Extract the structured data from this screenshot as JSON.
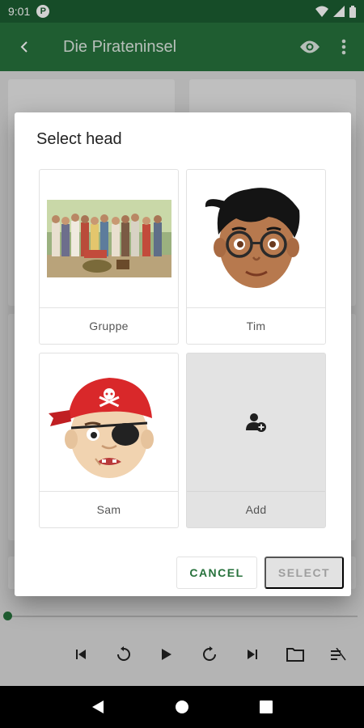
{
  "status_bar": {
    "time": "9:01",
    "notification_icon": "P"
  },
  "app_bar": {
    "title": "Die Pirateninsel"
  },
  "dialog": {
    "title": "Select head",
    "items": [
      {
        "label": "Gruppe",
        "image": "group-photo"
      },
      {
        "label": "Tim",
        "image": "boy-face-glasses"
      },
      {
        "label": "Sam",
        "image": "pirate-face-eyepatch"
      },
      {
        "label": "Add",
        "image": "add-person-icon"
      }
    ],
    "cancel_label": "CANCEL",
    "select_label": "SELECT"
  },
  "colors": {
    "status_bar": "#1c5d31",
    "app_bar": "#27723c",
    "accent": "#27723c"
  }
}
